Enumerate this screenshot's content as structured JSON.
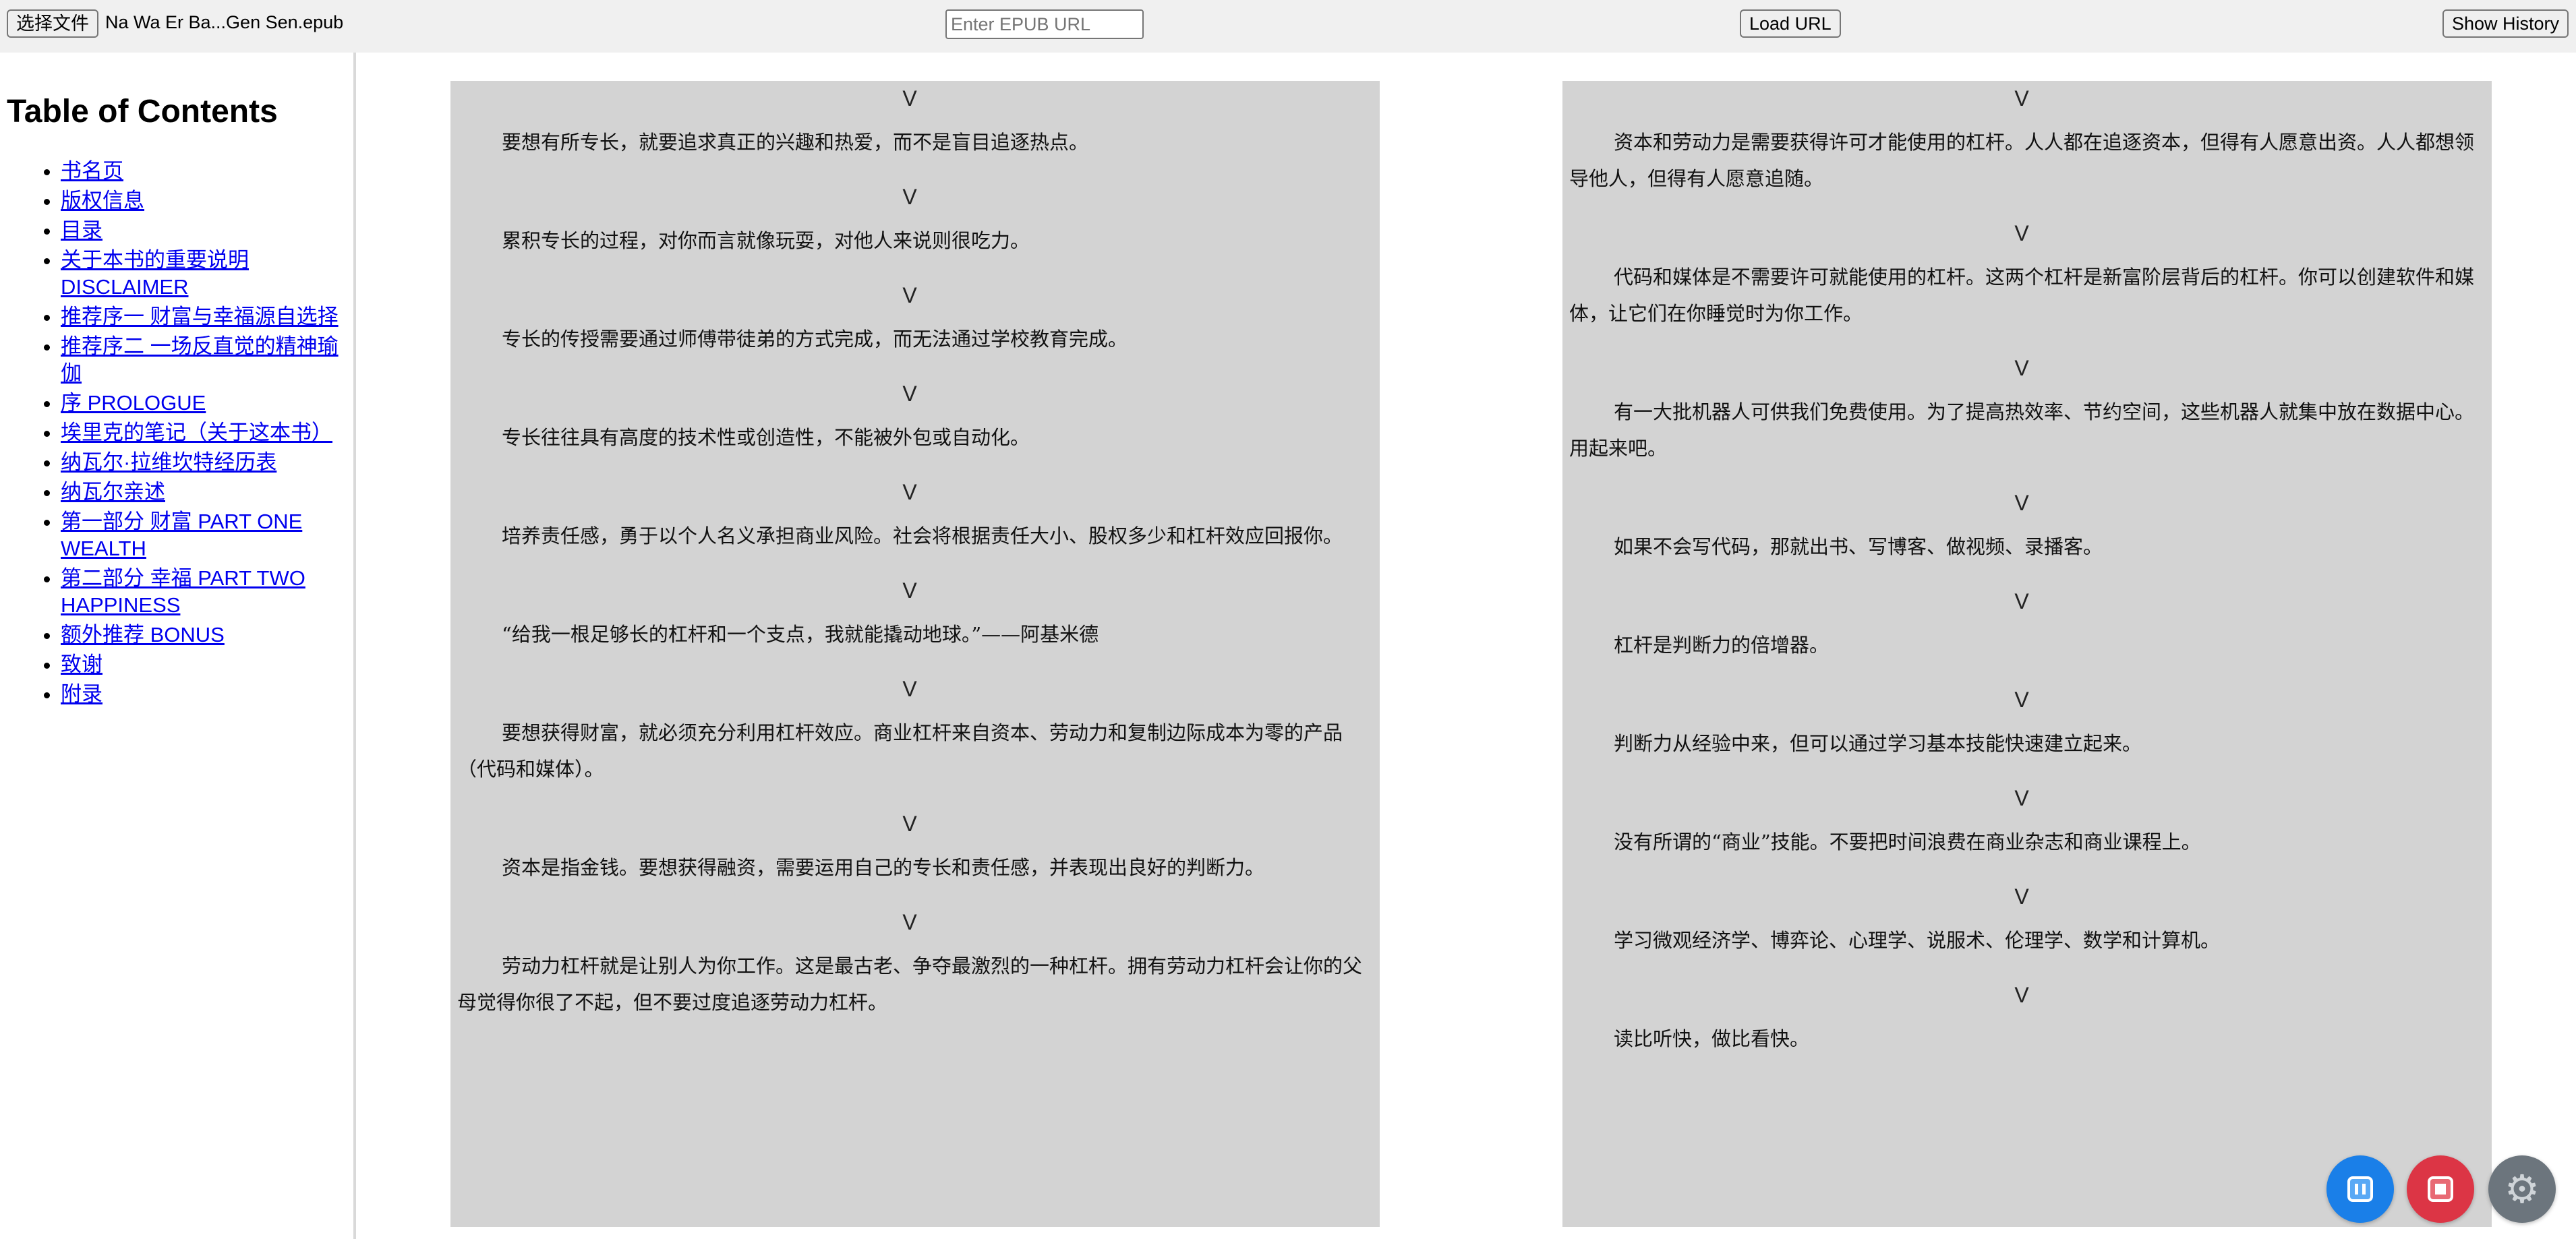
{
  "toolbar": {
    "file_button_label": "选择文件",
    "file_name": "Na Wa Er Ba...Gen Sen.epub",
    "url_placeholder": "Enter EPUB URL",
    "load_button_label": "Load URL",
    "history_button_label": "Show History"
  },
  "sidebar": {
    "title": "Table of Contents",
    "items": [
      {
        "label": "书名页"
      },
      {
        "label": "版权信息"
      },
      {
        "label": "目录"
      },
      {
        "label": "关于本书的重要说明 DISCLAIMER"
      },
      {
        "label": "推荐序一 财富与幸福源自选择"
      },
      {
        "label": "推荐序二 一场反直觉的精神瑜伽"
      },
      {
        "label": "序 PROLOGUE"
      },
      {
        "label": "埃里克的笔记（关于这本书）"
      },
      {
        "label": "纳瓦尔·拉维坎特经历表"
      },
      {
        "label": "纳瓦尔亲述"
      },
      {
        "label": "第一部分 财富 PART ONE WEALTH"
      },
      {
        "label": "第二部分 幸福 PART TWO HAPPINESS"
      },
      {
        "label": "额外推荐 BONUS"
      },
      {
        "label": "致谢"
      },
      {
        "label": "附录"
      }
    ]
  },
  "reader": {
    "separator": "V",
    "left_page": [
      "要想有所专长，就要追求真正的兴趣和热爱，而不是盲目追逐热点。",
      "累积专长的过程，对你而言就像玩耍，对他人来说则很吃力。",
      "专长的传授需要通过师傅带徒弟的方式完成，而无法通过学校教育完成。",
      "专长往往具有高度的技术性或创造性，不能被外包或自动化。",
      "培养责任感，勇于以个人名义承担商业风险。社会将根据责任大小、股权多少和杠杆效应回报你。",
      "“给我一根足够长的杠杆和一个支点，我就能撬动地球。”——阿基米德",
      "要想获得财富，就必须充分利用杠杆效应。商业杠杆来自资本、劳动力和复制边际成本为零的产品（代码和媒体）。",
      "资本是指金钱。要想获得融资，需要运用自己的专长和责任感，并表现出良好的判断力。",
      "劳动力杠杆就是让别人为你工作。这是最古老、争夺最激烈的一种杠杆。拥有劳动力杠杆会让你的父母觉得你很了不起，但不要过度追逐劳动力杠杆。"
    ],
    "right_page": [
      "资本和劳动力是需要获得许可才能使用的杠杆。人人都在追逐资本，但得有人愿意出资。人人都想领导他人，但得有人愿意追随。",
      "代码和媒体是不需要许可就能使用的杠杆。这两个杠杆是新富阶层背后的杠杆。你可以创建软件和媒体，让它们在你睡觉时为你工作。",
      "有一大批机器人可供我们免费使用。为了提高热效率、节约空间，这些机器人就集中放在数据中心。用起来吧。",
      "如果不会写代码，那就出书、写博客、做视频、录播客。",
      "杠杆是判断力的倍增器。",
      "判断力从经验中来，但可以通过学习基本技能快速建立起来。",
      "没有所谓的“商业”技能。不要把时间浪费在商业杂志和商业课程上。",
      "学习微观经济学、博弈论、心理学、说服术、伦理学、数学和计算机。",
      "读比听快，做比看快。"
    ]
  },
  "controls": {
    "pause_icon": "pause-icon",
    "stop_icon": "stop-icon",
    "settings_icon": "gear-icon",
    "pause_color": "#1a7fe8",
    "stop_color": "#dc3545",
    "settings_color": "#6c757d"
  }
}
